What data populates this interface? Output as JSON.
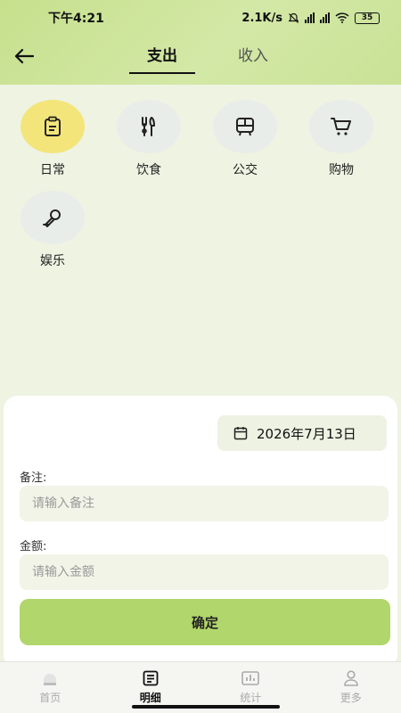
{
  "status": {
    "time": "下午4:21",
    "speed": "2.1K/s",
    "battery": "35"
  },
  "tabs": [
    {
      "label": "支出"
    },
    {
      "label": "收入"
    }
  ],
  "categories": [
    {
      "label": "日常",
      "icon": "clipboard-icon"
    },
    {
      "label": "饮食",
      "icon": "fork-knife-icon"
    },
    {
      "label": "公交",
      "icon": "bus-icon"
    },
    {
      "label": "购物",
      "icon": "cart-icon"
    },
    {
      "label": "娱乐",
      "icon": "microphone-icon"
    }
  ],
  "form": {
    "date": "2026年7月13日",
    "note_label": "备注:",
    "note_placeholder": "请输入备注",
    "amount_label": "金额:",
    "amount_placeholder": "请输入金额",
    "confirm": "确定"
  },
  "nav": [
    {
      "label": "首页"
    },
    {
      "label": "明细"
    },
    {
      "label": "统计"
    },
    {
      "label": "更多"
    }
  ],
  "colors": {
    "header": "#c6e08d",
    "accent": "#b1d66b",
    "selected": "#f3e57a"
  }
}
